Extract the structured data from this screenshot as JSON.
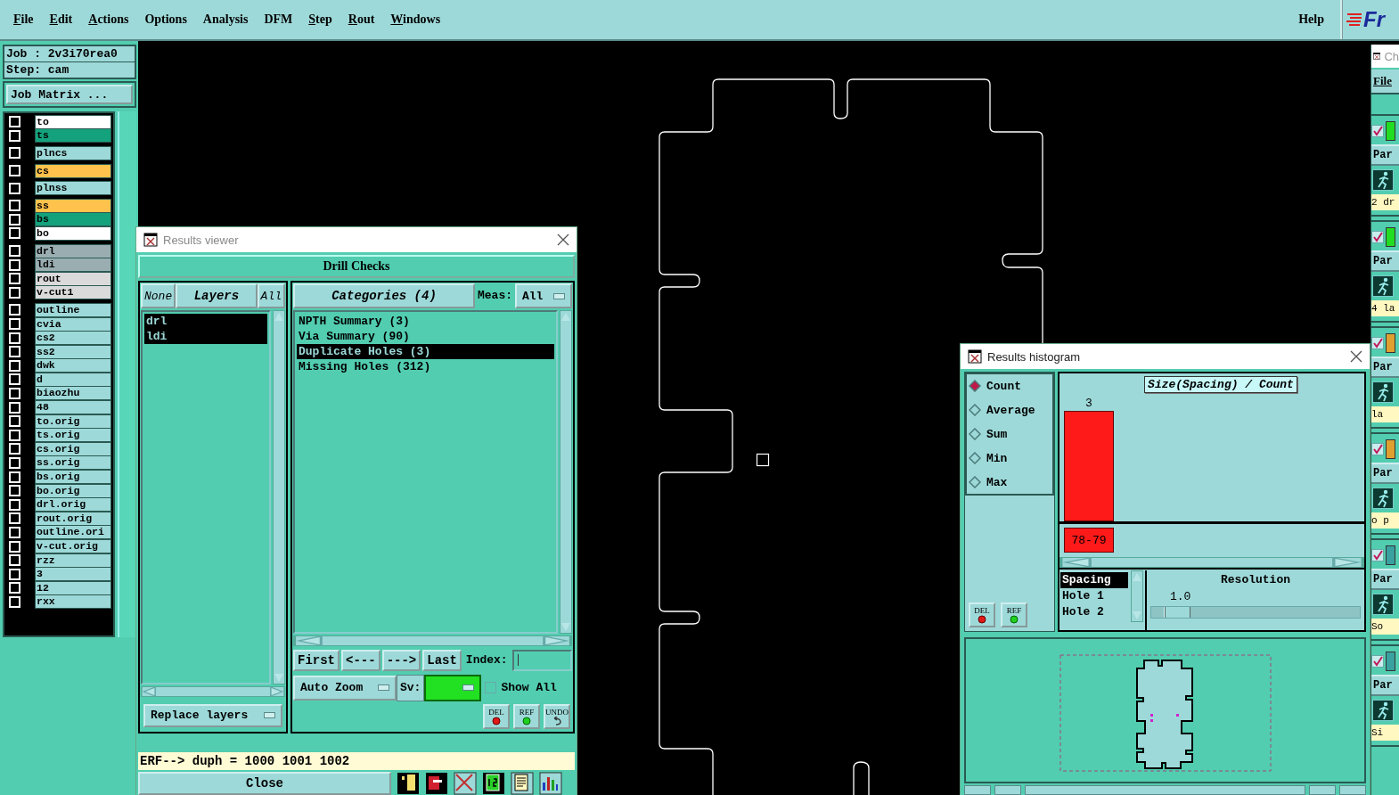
{
  "menu_bar": {
    "items": [
      {
        "label": "File",
        "mnemonic": true
      },
      {
        "label": "Edit",
        "mnemonic": true
      },
      {
        "label": "Actions",
        "mnemonic": true
      },
      {
        "label": "Options",
        "mnemonic": false
      },
      {
        "label": "Analysis",
        "mnemonic": false
      },
      {
        "label": "DFM",
        "mnemonic": false
      },
      {
        "label": "Step",
        "mnemonic": true
      },
      {
        "label": "Rout",
        "mnemonic": true
      },
      {
        "label": "Windows",
        "mnemonic": true
      }
    ],
    "help": "Help",
    "logo": "Fr"
  },
  "job_info": {
    "job": "Job : 2v3i70rea0",
    "step": "Step: cam",
    "matrix_button": "Job Matrix ..."
  },
  "layer_groups": [
    {
      "layers": [
        {
          "name": "to",
          "color": "#ffffff",
          "checked": false
        },
        {
          "name": "ts",
          "color": "#14a27c",
          "checked": false
        }
      ]
    },
    {
      "layers": [
        {
          "name": "plncs",
          "color": "#9ed9d9",
          "checked": false
        }
      ]
    },
    {
      "layers": [
        {
          "name": "cs",
          "color": "#ffc24c",
          "checked": false
        }
      ]
    },
    {
      "layers": [
        {
          "name": "plnss",
          "color": "#9ed9d9",
          "checked": false
        }
      ]
    },
    {
      "layers": [
        {
          "name": "ss",
          "color": "#ffc24c",
          "checked": false
        },
        {
          "name": "bs",
          "color": "#14a27c",
          "checked": false
        },
        {
          "name": "bo",
          "color": "#ffffff",
          "checked": false
        }
      ]
    },
    {
      "layers": [
        {
          "name": "drl",
          "color": "#9aaeb2",
          "checked": false
        },
        {
          "name": "ldi",
          "color": "#9aaeb2",
          "checked": false
        },
        {
          "name": "rout",
          "color": "#dadada",
          "checked": false
        },
        {
          "name": "v-cut1",
          "color": "#dadada",
          "checked": false
        }
      ]
    },
    {
      "layers": [
        {
          "name": "outline",
          "color": "#9ed9d9",
          "checked": false
        },
        {
          "name": "cvia",
          "color": "#9ed9d9",
          "checked": false
        },
        {
          "name": "cs2",
          "color": "#9ed9d9",
          "checked": false
        },
        {
          "name": "ss2",
          "color": "#9ed9d9",
          "checked": false
        },
        {
          "name": "dwk",
          "color": "#9ed9d9",
          "checked": false
        },
        {
          "name": "d",
          "color": "#9ed9d9",
          "checked": false
        },
        {
          "name": "biaozhu",
          "color": "#9ed9d9",
          "checked": false
        },
        {
          "name": "48",
          "color": "#9ed9d9",
          "checked": false
        },
        {
          "name": "to.orig",
          "color": "#9ed9d9",
          "checked": false
        },
        {
          "name": "ts.orig",
          "color": "#9ed9d9",
          "checked": false
        },
        {
          "name": "cs.orig",
          "color": "#9ed9d9",
          "checked": false
        },
        {
          "name": "ss.orig",
          "color": "#9ed9d9",
          "checked": false
        },
        {
          "name": "bs.orig",
          "color": "#9ed9d9",
          "checked": false
        },
        {
          "name": "bo.orig",
          "color": "#9ed9d9",
          "checked": false
        },
        {
          "name": "drl.orig",
          "color": "#9ed9d9",
          "checked": false
        },
        {
          "name": "rout.orig",
          "color": "#9ed9d9",
          "checked": false
        },
        {
          "name": "outline.ori",
          "color": "#9ed9d9",
          "checked": false
        },
        {
          "name": "v-cut.orig",
          "color": "#9ed9d9",
          "checked": false
        },
        {
          "name": "rzz",
          "color": "#9ed9d9",
          "checked": false
        },
        {
          "name": "3",
          "color": "#9ed9d9",
          "checked": false
        },
        {
          "name": "12",
          "color": "#9ed9d9",
          "checked": false
        },
        {
          "name": "rxx",
          "color": "#9ed9d9",
          "checked": false
        }
      ]
    }
  ],
  "results_viewer": {
    "title": "Results viewer",
    "header": "Drill Checks",
    "layer_buttons": [
      {
        "label": "None",
        "kind": "option"
      },
      {
        "label": "Layers",
        "kind": "heading"
      },
      {
        "label": "All",
        "kind": "option"
      }
    ],
    "layers": [
      {
        "name": "drl",
        "selected": true
      },
      {
        "name": "ldi",
        "selected": true
      }
    ],
    "categories_button": "Categories (4)",
    "meas_label": "Meas:",
    "meas_value": "All",
    "categories": [
      {
        "label": "NPTH Summary (3)",
        "selected": false
      },
      {
        "label": "Via Summary (90)",
        "selected": false
      },
      {
        "label": "Duplicate Holes (3)",
        "selected": true
      },
      {
        "label": "Missing Holes (312)",
        "selected": false
      }
    ],
    "nav_buttons": [
      "First",
      "<---",
      "--->",
      "Last"
    ],
    "index_label": "Index:",
    "auto_zoom": "Auto Zoom",
    "sv_label": "Sv:",
    "show_all": {
      "label": "Show All",
      "checked": false
    },
    "action_buttons": [
      {
        "label": "DEL",
        "kind": "del"
      },
      {
        "label": "REF",
        "kind": "ref"
      },
      {
        "label": "UNDO",
        "kind": "undo"
      }
    ],
    "replace_layers": "Replace layers",
    "status": "ERF--> duph = 1000 1001 1002",
    "close": "Close"
  },
  "histogram": {
    "title": "Results histogram",
    "modes": [
      {
        "label": "Count",
        "selected": true
      },
      {
        "label": "Average",
        "selected": false
      },
      {
        "label": "Sum",
        "selected": false
      },
      {
        "label": "Min",
        "selected": false
      },
      {
        "label": "Max",
        "selected": false
      }
    ],
    "buttons": [
      {
        "label": "DEL",
        "kind": "del"
      },
      {
        "label": "REF",
        "kind": "ref"
      }
    ],
    "chart_title": "Size(Spacing) / Count",
    "bins": [
      {
        "count": "3",
        "label": "78-79"
      }
    ],
    "fields": [
      {
        "label": "Spacing",
        "selected": true
      },
      {
        "label": "Hole 1",
        "selected": false
      },
      {
        "label": "Hole 2",
        "selected": false
      }
    ],
    "resolution": {
      "label": "Resolution",
      "value": "1.0",
      "level": 0.06
    }
  },
  "side_window": {
    "title": "Ch",
    "menu": "File",
    "rows": [
      {
        "checked": true,
        "color": "#22dd22",
        "button": "Par",
        "text": "2 dr"
      },
      {
        "checked": true,
        "color": "#22dd22",
        "button": "Par",
        "text": "4 la"
      },
      {
        "checked": true,
        "color": "#e0a030",
        "button": "Par",
        "text": "la"
      },
      {
        "checked": true,
        "color": "#e0a030",
        "button": "Par",
        "text": "o p"
      },
      {
        "checked": true,
        "color": "#3aa0a0",
        "button": "Par",
        "text": "So"
      },
      {
        "checked": true,
        "color": "#3aa0a0",
        "button": "Par",
        "text": "Si"
      }
    ]
  }
}
